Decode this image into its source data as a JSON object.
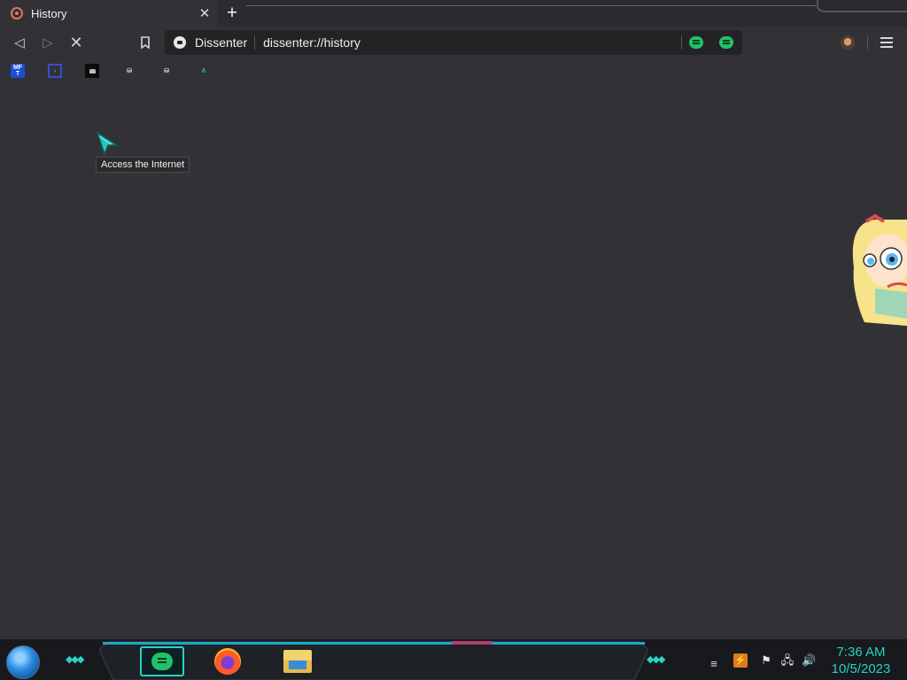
{
  "tab": {
    "title": "History",
    "close_glyph": "✕",
    "new_tab_glyph": "+"
  },
  "toolbar": {
    "back_glyph": "◁",
    "forward_glyph": "▷",
    "stop_glyph": "✕",
    "bookmark_glyph": "🔖",
    "site_name": "Dissenter",
    "url": "dissenter://history"
  },
  "bookmarks": [
    {
      "label": "",
      "icon": "mediafire-icon"
    },
    {
      "label": "",
      "icon": "glass-icon"
    },
    {
      "label": "",
      "icon": "password-icon"
    },
    {
      "label": "",
      "icon": "dungeon-icon"
    },
    {
      "label": "",
      "icon": "vnc-icon"
    },
    {
      "label": "",
      "icon": "captcha-icon"
    }
  ],
  "page": {
    "tooltip": "Access the Internet"
  },
  "taskbar": {
    "time": "7:36 AM",
    "date": "10/5/2023",
    "accent": "#2ad1c6"
  },
  "colors": {
    "background": "#323236",
    "tab_strip": "#2b2a2f",
    "gab_green": "#21c16b"
  }
}
